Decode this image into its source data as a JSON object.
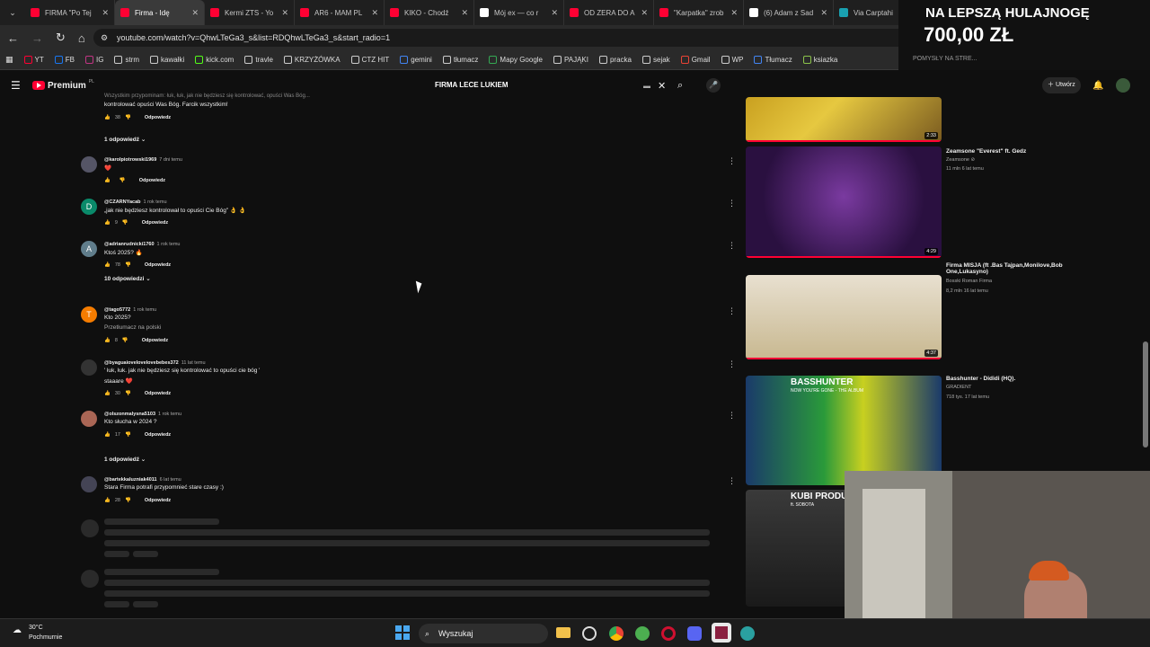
{
  "tabs": [
    {
      "title": "FIRMA \"Po Tej",
      "color": "#ff0033"
    },
    {
      "title": "Firma - Idę",
      "color": "#ff0033",
      "active": true
    },
    {
      "title": "Kermi ZTS - Yo",
      "color": "#ff0033"
    },
    {
      "title": "AR6 - MAM PL",
      "color": "#ff0033"
    },
    {
      "title": "KIKO - Chodź",
      "color": "#ff0033"
    },
    {
      "title": "Mój ex — co r",
      "color": "#ffffff"
    },
    {
      "title": "OD ZERA DO A",
      "color": "#ff0033"
    },
    {
      "title": "\"Karpatka\" zrob",
      "color": "#ff0033"
    },
    {
      "title": "(6) Adam z Sad",
      "color": "#ffffff"
    },
    {
      "title": "Via Carptahi",
      "color": "#19a0b0"
    }
  ],
  "url": "youtube.com/watch?v=QhwLTeGa3_s&list=RDQhwLTeGa3_s&start_radio=1",
  "bookmarks": [
    "YT",
    "FB",
    "IG",
    "strm",
    "kawałki",
    "kick.com",
    "travle",
    "KRZYŻÓWKA",
    "CTZ HIT",
    "gemini",
    "tłumacz",
    "Mapy Google",
    "PAJĄKI",
    "pracka",
    "sejak",
    "Gmail",
    "WP",
    "Tłumacz",
    "ksiazka"
  ],
  "bookmarks_right": "POMYSŁY NA STRE...",
  "promo": {
    "line1": "NA LEPSZĄ HULAJNOGĘ",
    "line2": "700,00 ZŁ"
  },
  "yt": {
    "logo": "Premium",
    "country": "PL",
    "search": "FIRMA LECE LUKIEM",
    "create": "Utwórz"
  },
  "top_comment": {
    "text": "kontrolować opuści Was Bóg. Farcik wszystkim!",
    "likes": "38",
    "reply": "Odpowiedz",
    "replies": "1 odpowiedź"
  },
  "comments": [
    {
      "user": "@karolpiotrowski1969",
      "time": "7 dni temu",
      "text": "❤️",
      "likes": "",
      "reply": "Odpowiedz",
      "avatar": "",
      "avcolor": "#556"
    },
    {
      "user": "@CZARNYacab",
      "time": "1 rok temu",
      "text": "„jak nie będziesz kontrolował to opuści Cie Bóg” 👌 👌",
      "likes": "9",
      "reply": "Odpowiedz",
      "avatar": "D",
      "avcolor": "#0a8a6a"
    },
    {
      "user": "@adrianrudnicki1760",
      "time": "1 rok temu",
      "text": "Ktoś 2025? 🔥",
      "likes": "78",
      "reply": "Odpowiedz",
      "avatar": "A",
      "avcolor": "#607d8b",
      "replies": "10 odpowiedzi"
    },
    {
      "user": "@tago5772",
      "time": "1 rok temu",
      "text": "Kto 2025?",
      "text2": "Przetłumacz na polski",
      "likes": "8",
      "reply": "Odpowiedz",
      "avatar": "T",
      "avcolor": "#f57c00"
    },
    {
      "user": "@byaguaiovelovelovebebes372",
      "time": "11 lat temu",
      "text": "' łuk, łuk. jak nie będziesz się kontrolować to opuści cie bóg '",
      "text2": "staaare ❤️",
      "likes": "30",
      "reply": "Odpowiedz",
      "avatar": "",
      "avcolor": "#333"
    },
    {
      "user": "@olszonmalysna5103",
      "time": "1 rok temu",
      "text": "Kto słucha w 2024 ?",
      "likes": "17",
      "reply": "Odpowiedz",
      "avatar": "",
      "avcolor": "#a65"
    },
    {
      "user": "@bartekkaluzniak4011",
      "time": "6 lat temu",
      "text": "Stara Firma potrafi przypomnieć stare czasy :)",
      "likes": "28",
      "reply": "Odpowiedz",
      "avatar": "",
      "avcolor": "#445",
      "replies_before": "1 odpowiedź"
    }
  ],
  "videos": [
    {
      "duration": "2:33",
      "title": "",
      "meta1": "",
      "meta2": ""
    },
    {
      "duration": "4:29",
      "title": "Zeamsone \"Everest\" ft. Gedz",
      "meta1": "Zeamsone ⊘",
      "meta2": "11 mln  6 lat temu"
    },
    {
      "duration": "4:37",
      "title": "Firma  MISJA (ft .Bas Tajpan,Monilove,Bob One,Lukasyno)",
      "meta1": "Bosski Roman Firma",
      "meta2": "8,2 mln  16 lat temu"
    },
    {
      "duration": "",
      "title": "Basshunter - Dididi (HQ).",
      "meta1": "GRADIENT",
      "meta2": "718 tys.  17 lat temu",
      "thumb_text": "BASSHUNTER",
      "thumb_sub": "NOW YOU'RE GONE - THE ALBUM"
    },
    {
      "duration": "",
      "title": "",
      "meta1": "",
      "meta2": "",
      "thumb_text": "KUBI PRODUCENT",
      "thumb_sub": "ft. SOBOTA"
    }
  ],
  "taskbar": {
    "temp": "30°C",
    "weather": "Pochmurnie",
    "search": "Wyszukaj"
  },
  "colors": {
    "accent": "#ff0033",
    "bg": "#0f0f0f"
  }
}
